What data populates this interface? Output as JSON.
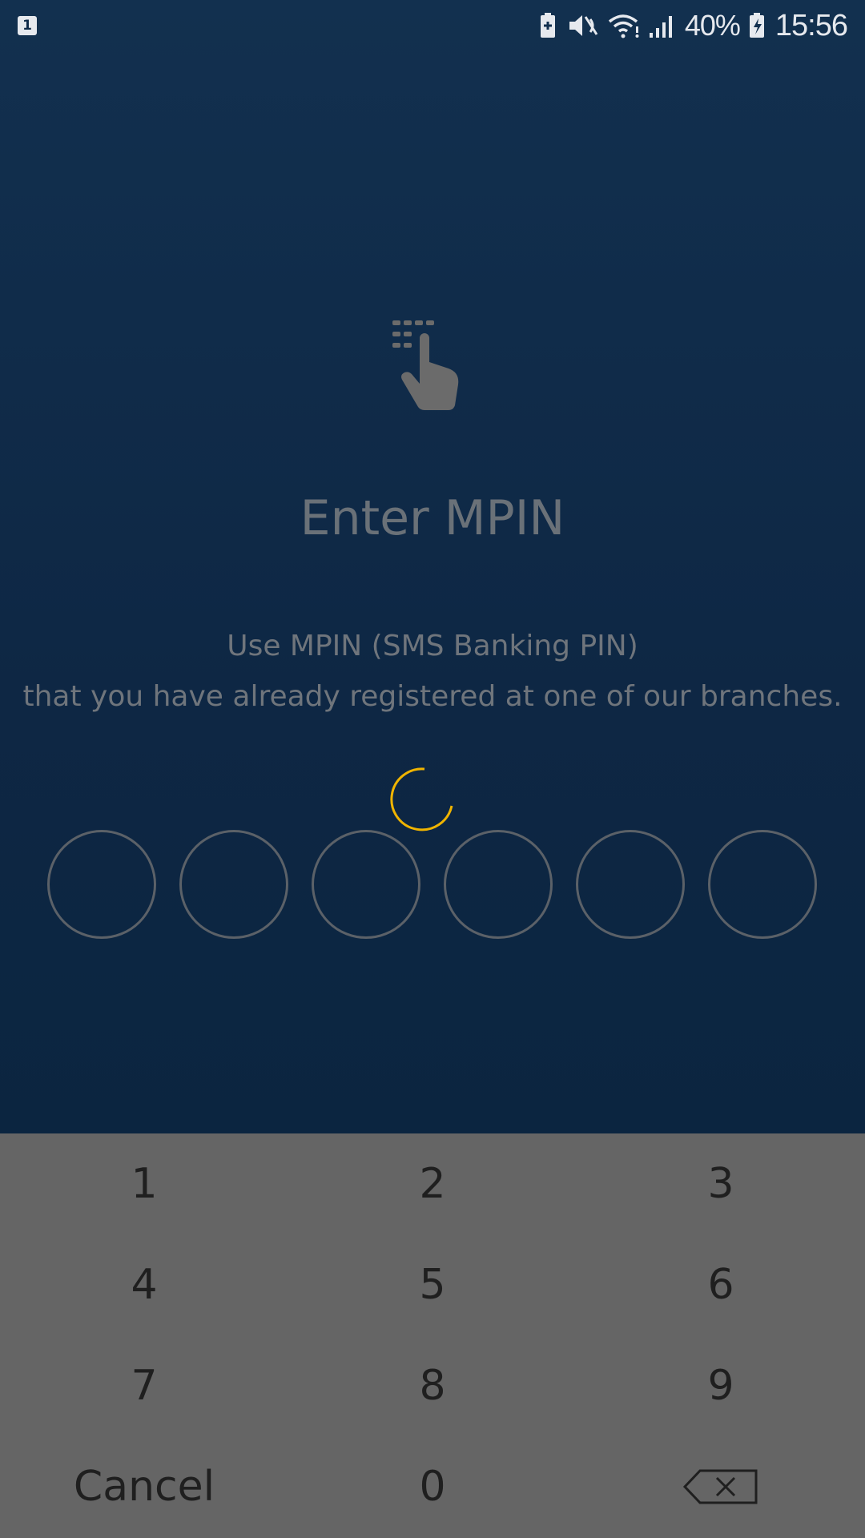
{
  "status_bar": {
    "sim_indicator": "1",
    "battery_percent": "40%",
    "time": "15:56",
    "icons": [
      "battery-saver-icon",
      "mute-icon",
      "wifi-icon",
      "signal-icon",
      "battery-charging-icon"
    ]
  },
  "mpin_screen": {
    "hero_icon": "keypad-touch-icon",
    "title": "Enter MPIN",
    "description_line1": "Use MPIN (SMS Banking PIN)",
    "description_line2": "that you have already registered at one of our branches.",
    "pin_length": 6,
    "loading": true
  },
  "keypad": {
    "keys": [
      "1",
      "2",
      "3",
      "4",
      "5",
      "6",
      "7",
      "8",
      "9"
    ],
    "cancel_label": "Cancel",
    "zero_label": "0",
    "backspace_icon": "backspace-icon"
  },
  "colors": {
    "background_top": "#12304f",
    "background_bottom": "#0b2540",
    "text_muted": "#6a7178",
    "pin_outline": "#5b6168",
    "spinner": "#f0b400",
    "keypad_bg": "#656565",
    "key_text": "#1f1f1f"
  }
}
